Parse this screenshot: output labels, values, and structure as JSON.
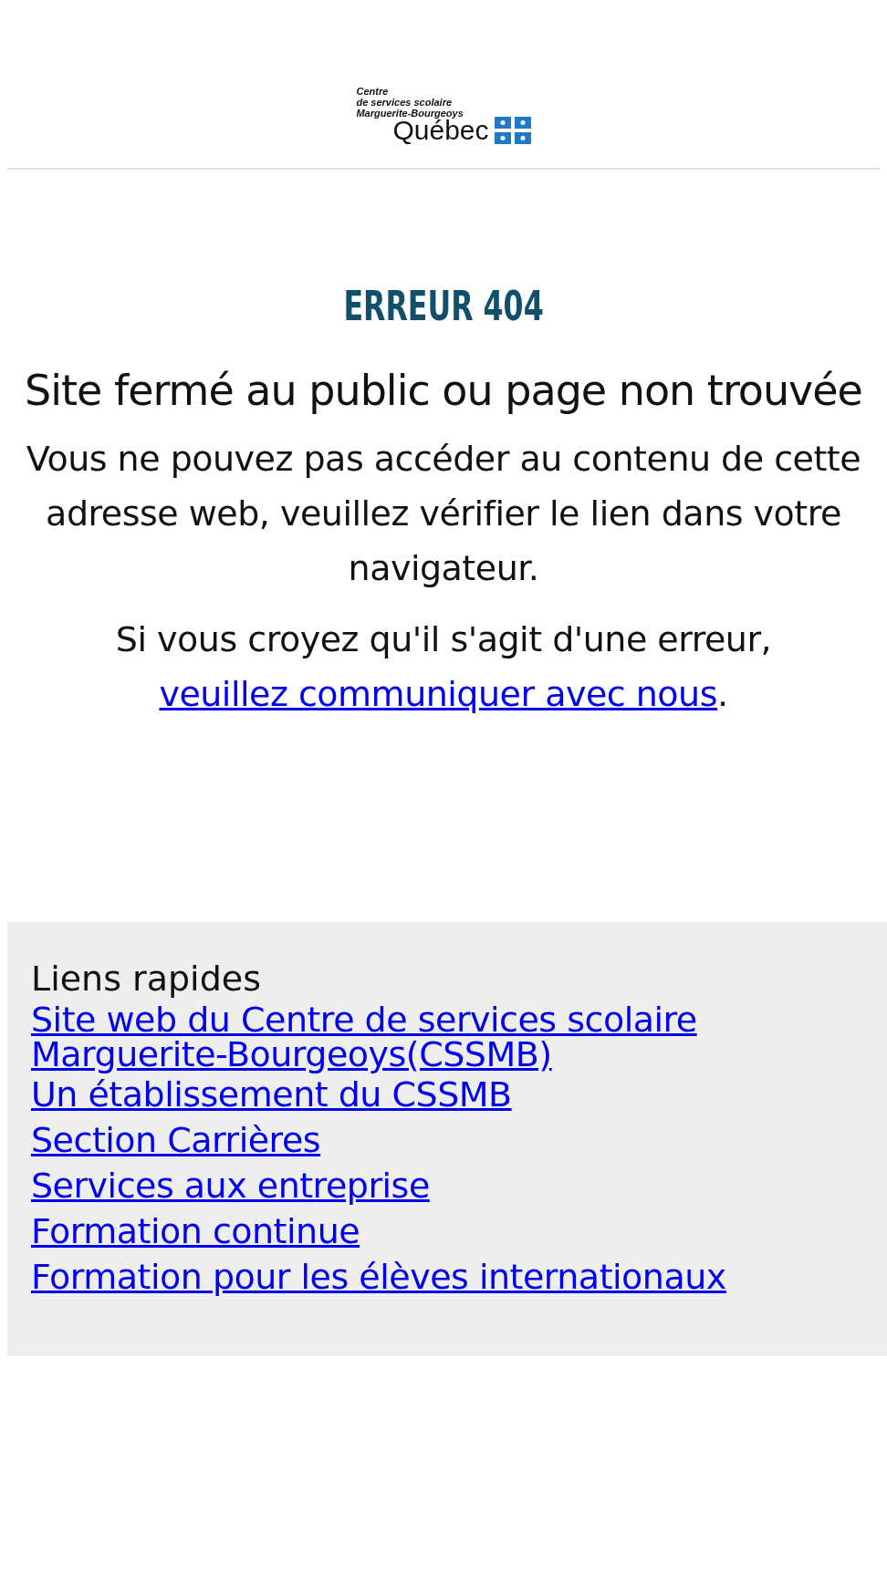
{
  "logo": {
    "lines": [
      "Centre",
      "de services scolaire",
      "Marguerite-Bourgeoys"
    ],
    "wordmark": "Québec"
  },
  "error_banner": "ERREUR 404",
  "heading": "Site fermé au public ou page non trouvée",
  "message": "Vous ne pouvez pas accéder au contenu de cette adresse web, veuillez vérifier le lien dans votre navigateur.",
  "contact": {
    "text": "Si vous croyez qu'il s'agit d'une erreur,",
    "link": "veuillez communiquer avec nous",
    "end": "."
  },
  "quick_links": {
    "title": "Liens rapides",
    "links": [
      "Site web du Centre de services scolaire Marguerite-Bourgeoys(CSSMB)",
      "Un établissement du CSSMB",
      "Section Carrières",
      "Services aux entreprise",
      "Formation continue",
      "Formation pour les élèves internationaux"
    ]
  }
}
